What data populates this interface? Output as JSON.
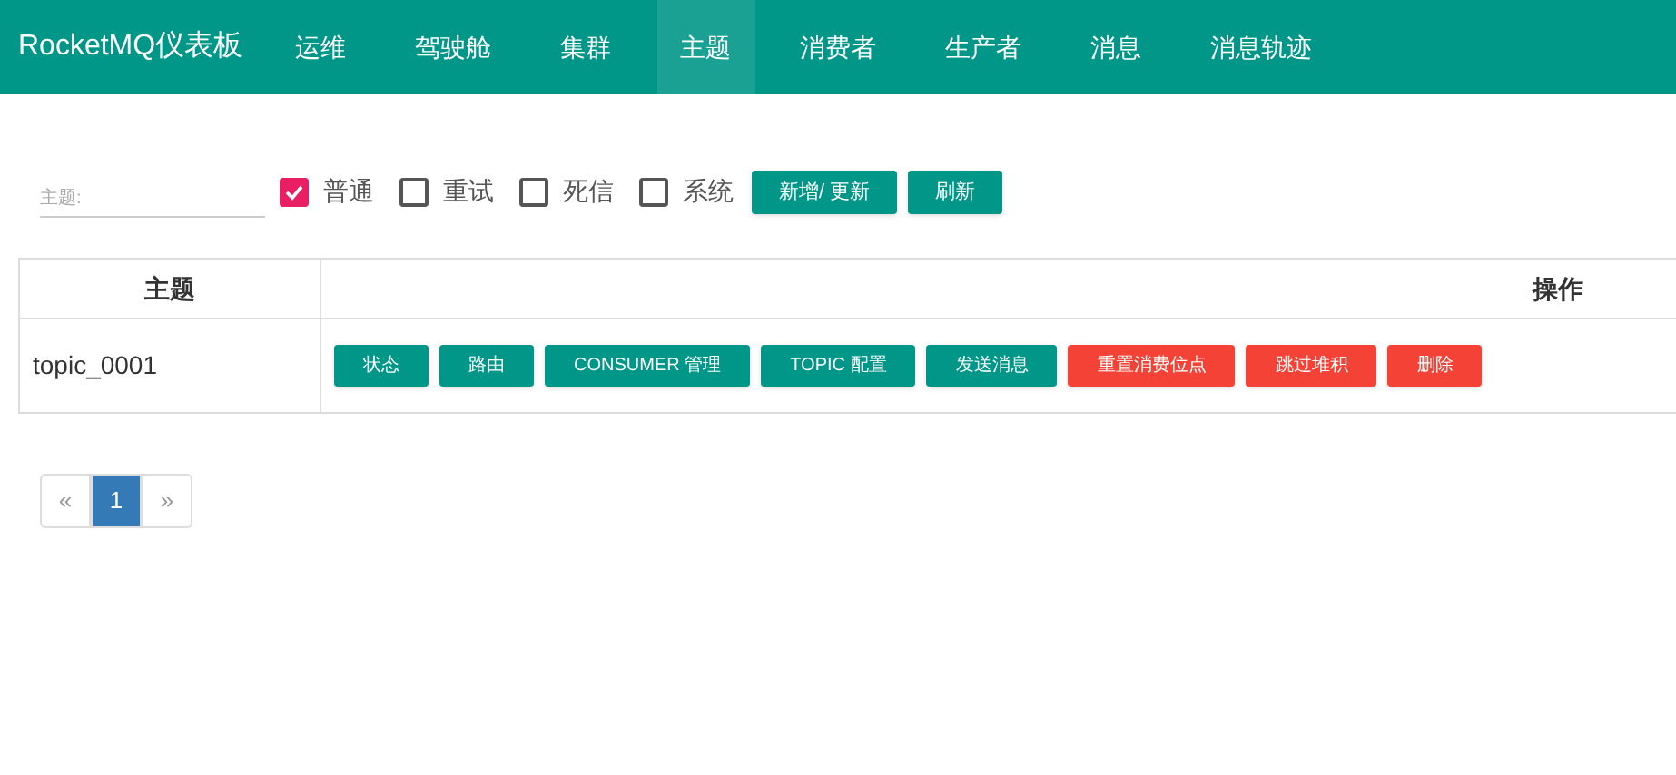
{
  "brand": "RocketMQ仪表板",
  "nav": [
    {
      "label": "运维",
      "selected": false
    },
    {
      "label": "驾驶舱",
      "selected": false
    },
    {
      "label": "集群",
      "selected": false
    },
    {
      "label": "主题",
      "selected": true
    },
    {
      "label": "消费者",
      "selected": false
    },
    {
      "label": "生产者",
      "selected": false
    },
    {
      "label": "消息",
      "selected": false
    },
    {
      "label": "消息轨迹",
      "selected": false
    }
  ],
  "filter": {
    "label": "主题:",
    "filters": [
      {
        "label": "普通",
        "checked": true
      },
      {
        "label": "重试",
        "checked": false
      },
      {
        "label": "死信",
        "checked": false
      },
      {
        "label": "系统",
        "checked": false
      }
    ],
    "buttons": [
      "新增/ 更新",
      "刷新"
    ]
  },
  "table": {
    "columns": [
      "主题",
      "操作"
    ],
    "rows": [
      {
        "topic": "topic_0001",
        "actions": [
          {
            "label": "状态",
            "kind": "primary"
          },
          {
            "label": "路由",
            "kind": "primary"
          },
          {
            "label": "CONSUMER 管理",
            "kind": "primary"
          },
          {
            "label": "TOPIC 配置",
            "kind": "primary"
          },
          {
            "label": "发送消息",
            "kind": "primary"
          },
          {
            "label": "重置消费位点",
            "kind": "danger"
          },
          {
            "label": "跳过堆积",
            "kind": "danger"
          },
          {
            "label": "删除",
            "kind": "danger"
          }
        ]
      }
    ]
  },
  "pagination": {
    "prev": "«",
    "pages": [
      {
        "label": "1",
        "selected": true
      }
    ],
    "next": "»"
  }
}
